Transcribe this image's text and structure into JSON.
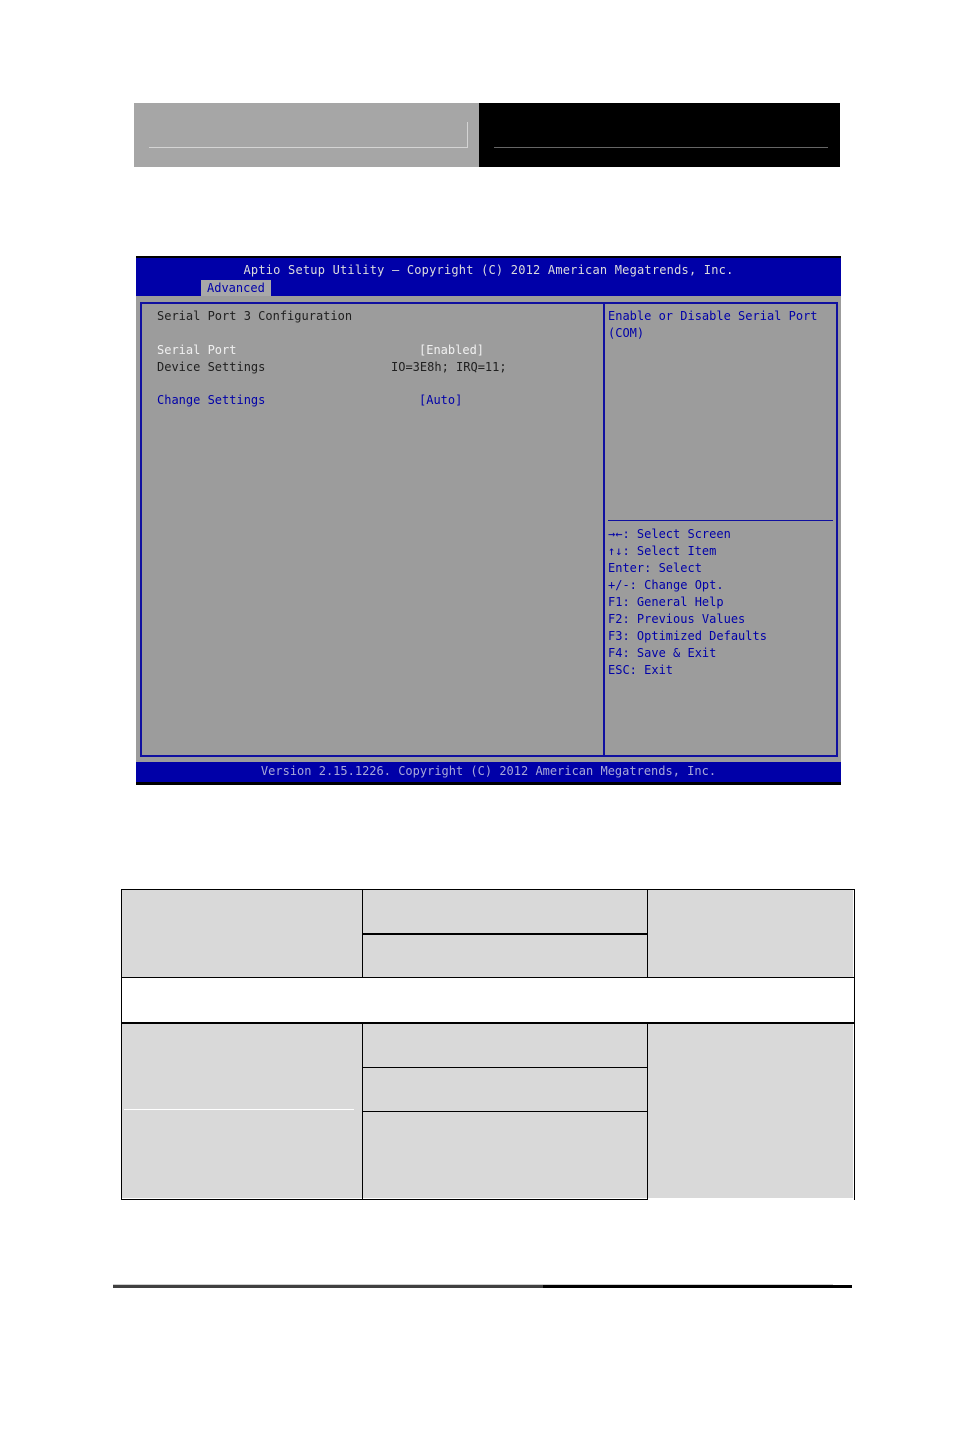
{
  "bios": {
    "title": "Aptio Setup Utility – Copyright (C) 2012 American Megatrends, Inc.",
    "active_tab": "Advanced",
    "footer": "Version 2.15.1226. Copyright (C) 2012 American Megatrends, Inc.",
    "section_title": "Serial Port 3 Configuration",
    "items": [
      {
        "label": "Serial Port",
        "value": "[Enabled]"
      },
      {
        "label": "Device Settings",
        "value": "IO=3E8h; IRQ=11;"
      },
      {
        "label": "Change Settings",
        "value": "[Auto]"
      }
    ],
    "help_text": [
      "Enable or Disable Serial Port",
      "(COM)"
    ],
    "keys": [
      {
        "icon": "left-right-arrows-icon",
        "glyph": "→←",
        "text": ": Select Screen"
      },
      {
        "icon": "up-down-arrows-icon",
        "glyph": "↑↓",
        "text": ": Select Item"
      },
      {
        "text": "Enter: Select"
      },
      {
        "text": "+/-: Change Opt."
      },
      {
        "text": "F1: General Help"
      },
      {
        "text": "F2: Previous Values"
      },
      {
        "text": "F3: Optimized Defaults"
      },
      {
        "text": "F4: Save & Exit"
      },
      {
        "text": "ESC: Exit"
      }
    ],
    "colors": {
      "header_bg": "#0000a8",
      "body_bg": "#9c9c9c",
      "border": "#1010a0",
      "highlight_text": "#0000a8",
      "selected_text": "#f0f0f0"
    }
  }
}
